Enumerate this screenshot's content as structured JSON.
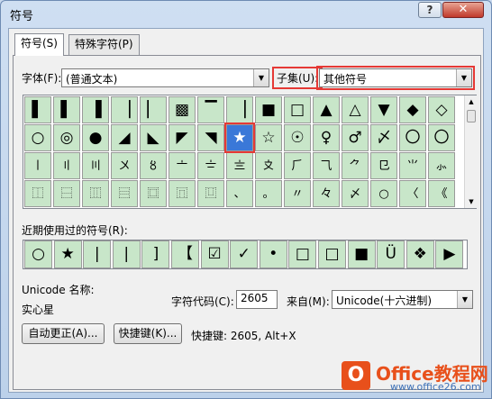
{
  "window": {
    "title": "符号",
    "help_glyph": "?",
    "close_glyph": "✕"
  },
  "tabs": [
    {
      "label": "符号(S)"
    },
    {
      "label": "特殊字符(P)"
    }
  ],
  "font": {
    "label": "字体(F):",
    "value": "(普通文本)"
  },
  "subset": {
    "label": "子集(U):",
    "value": "其他符号"
  },
  "symbols": [
    [
      "▌",
      "▌",
      "▐",
      "▕",
      "▏",
      "▩",
      "▔",
      "▕",
      "■",
      "□",
      "▲",
      "△",
      "▼",
      "◆",
      "◇"
    ],
    [
      "○",
      "◎",
      "●",
      "◢",
      "◣",
      "◤",
      "◥",
      "★",
      "☆",
      "☉",
      "♀",
      "♂",
      "〆",
      "〇",
      "〇"
    ],
    [
      "〡",
      "〢",
      "〣",
      "〤",
      "〥",
      "〦",
      "〧",
      "〨",
      "〩",
      "⺁",
      "⺄",
      "⺈",
      "⺋",
      "⺌",
      "⺗"
    ],
    [
      "⿰",
      "⿱",
      "⿲",
      "⿳",
      "⿴",
      "⿵",
      "⿶",
      "、",
      "。",
      "〃",
      "々",
      "〆",
      "○",
      "〈",
      "《"
    ]
  ],
  "selected_symbol": "★",
  "recent": {
    "label": "近期使用过的符号(R):",
    "items": [
      "○",
      "★",
      "|",
      "|",
      "]",
      "【",
      "☑",
      "✓",
      "•",
      "□",
      "□",
      "■",
      "Ü",
      "❖",
      "▶"
    ]
  },
  "unicode": {
    "name_label": "Unicode 名称:",
    "name_value": "实心星"
  },
  "charcode": {
    "label": "字符代码(C):",
    "value": "2605"
  },
  "from": {
    "label": "来自(M):",
    "value": "Unicode(十六进制)"
  },
  "buttons": {
    "autocorrect": "自动更正(A)...",
    "shortcut": "快捷键(K)..."
  },
  "shortcut_info": "快捷键: 2605, Alt+X",
  "watermark": {
    "logo_char": "O",
    "brand": "Office教程网",
    "url": "www.office26.com"
  }
}
